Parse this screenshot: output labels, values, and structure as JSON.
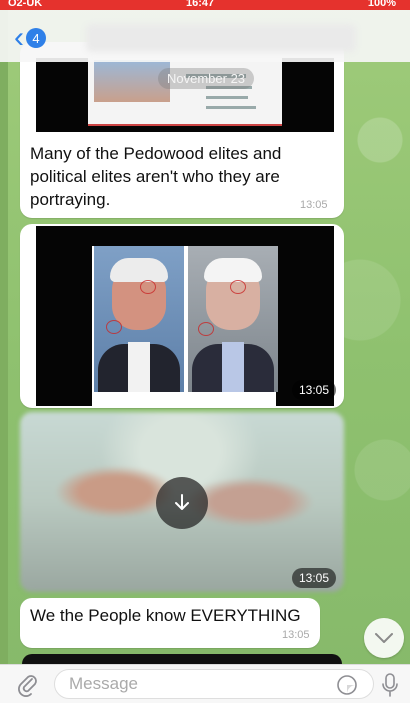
{
  "status_bar": {
    "carrier": "O2-UK",
    "time": "16:47",
    "battery": "100%"
  },
  "nav": {
    "back_count": "4"
  },
  "messages": [
    {
      "date_chip": "November 23",
      "text": "Many of the Pedowood elites and political elites aren't who they are portraying.",
      "time": "13:05"
    },
    {
      "type": "photo",
      "time": "13:05"
    },
    {
      "type": "video",
      "time": "13:05"
    },
    {
      "text": "We the People know EVERYTHING",
      "time": "13:05"
    }
  ],
  "input": {
    "placeholder": "Message"
  },
  "icons": {
    "back": "chevron-left-icon",
    "attach": "paperclip-icon",
    "sticker": "sticker-icon",
    "mic": "microphone-icon",
    "download": "arrow-down-icon",
    "scroll_down": "chevron-down-icon"
  },
  "colors": {
    "status_bar": "#e5322d",
    "accent": "#2f80e8",
    "wallpaper": "#8fc16f"
  }
}
